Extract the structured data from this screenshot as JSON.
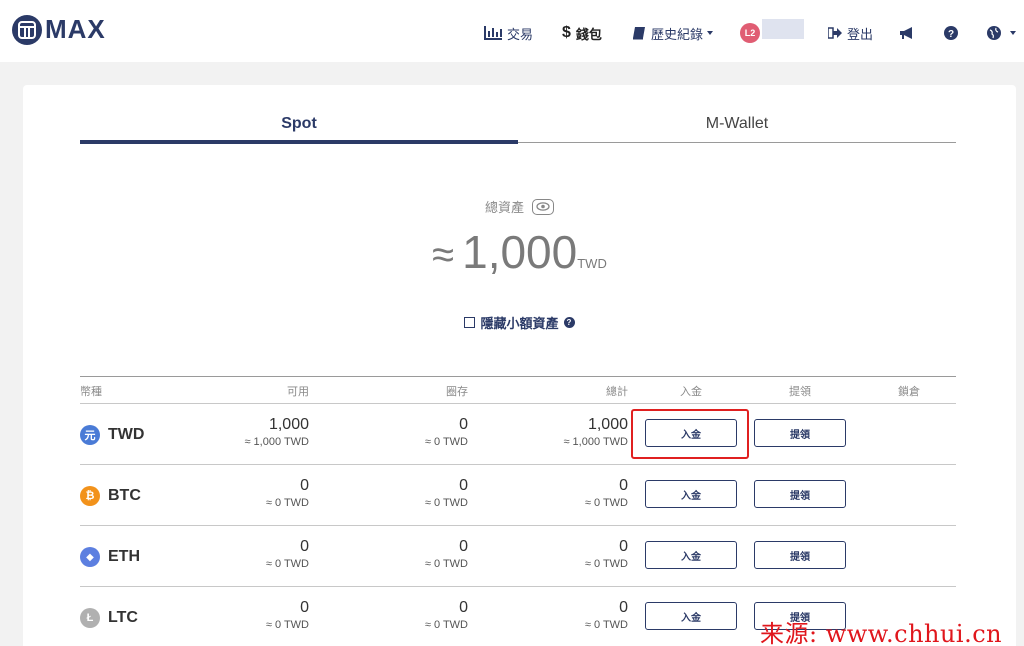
{
  "brand": {
    "name": "MAX"
  },
  "nav": {
    "trade": "交易",
    "wallet_symbol": "$",
    "wallet": "錢包",
    "history": "歷史紀錄",
    "level": "L2",
    "logout": "登出"
  },
  "tabs": [
    {
      "label": "Spot",
      "active": true
    },
    {
      "label": "M-Wallet",
      "active": false
    }
  ],
  "summary": {
    "label": "總資產",
    "approx": "≈",
    "value": "1,000",
    "unit": "TWD",
    "hide_small": "隱藏小額資產"
  },
  "table": {
    "columns": {
      "currency": "幣種",
      "available": "可用",
      "locked": "圈存",
      "total": "總計",
      "deposit": "入金",
      "withdraw": "提領",
      "lock": "鎖倉"
    },
    "rows": [
      {
        "symbol": "TWD",
        "icon": "元",
        "icon_color": "#4a7bd6",
        "available": "1,000",
        "available_sub": "≈ 1,000 TWD",
        "locked": "0",
        "locked_sub": "≈ 0 TWD",
        "total": "1,000",
        "total_sub": "≈ 1,000 TWD",
        "deposit": "入金",
        "withdraw": "提領"
      },
      {
        "symbol": "BTC",
        "icon": "₿",
        "icon_color": "#f2921b",
        "available": "0",
        "available_sub": "≈ 0 TWD",
        "locked": "0",
        "locked_sub": "≈ 0 TWD",
        "total": "0",
        "total_sub": "≈ 0 TWD",
        "deposit": "入金",
        "withdraw": "提領"
      },
      {
        "symbol": "ETH",
        "icon": "◆",
        "icon_color": "#5c7fe0",
        "available": "0",
        "available_sub": "≈ 0 TWD",
        "locked": "0",
        "locked_sub": "≈ 0 TWD",
        "total": "0",
        "total_sub": "≈ 0 TWD",
        "deposit": "入金",
        "withdraw": "提領"
      },
      {
        "symbol": "LTC",
        "icon": "Ł",
        "icon_color": "#b0b0b0",
        "available": "0",
        "available_sub": "≈ 0 TWD",
        "locked": "0",
        "locked_sub": "≈ 0 TWD",
        "total": "0",
        "total_sub": "≈ 0 TWD",
        "deposit": "入金",
        "withdraw": "提領"
      }
    ]
  },
  "watermark": "来源: www.chhui.cn",
  "colors": {
    "brand": "#2b3a67",
    "highlight": "#e02020",
    "watermark": "#e0161c"
  }
}
